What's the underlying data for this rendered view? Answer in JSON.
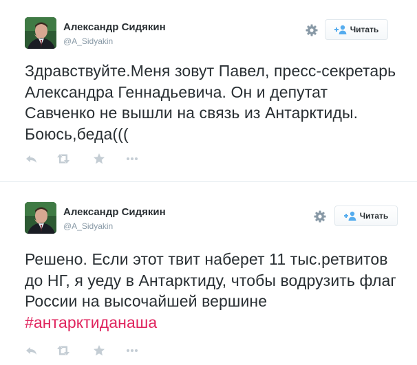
{
  "tweets": [
    {
      "author": {
        "name": "Александр Сидякин",
        "handle": "@A_Sidyakin"
      },
      "follow_label": "Читать",
      "text": "Здравствуйте.Меня зовут Павел, пресс-секретарь Александра Геннадьевича. Он и депутат Савченко не вышли на связь из Антарктиды. Боюсь,беда(((",
      "hashtag": "",
      "actions": [
        "reply-icon",
        "retweet-icon",
        "favorite-icon",
        "more-icon"
      ]
    },
    {
      "author": {
        "name": "Александр Сидякин",
        "handle": "@A_Sidyakin"
      },
      "follow_label": "Читать",
      "text": "Решено. Если этот твит наберет 11 тыс.ретвитов до НГ, я уеду в Антарктиду, чтобы водрузить флаг России на высочайшей вершине ",
      "hashtag": "#антарктиданаша",
      "actions": [
        "reply-icon",
        "retweet-icon",
        "favorite-icon",
        "more-icon"
      ]
    }
  ],
  "colors": {
    "text": "#292f33",
    "muted": "#8899a6",
    "hashtag": "#e0245e",
    "follow_icon": "#55acee",
    "icon_gray": "#c4cdd4"
  }
}
